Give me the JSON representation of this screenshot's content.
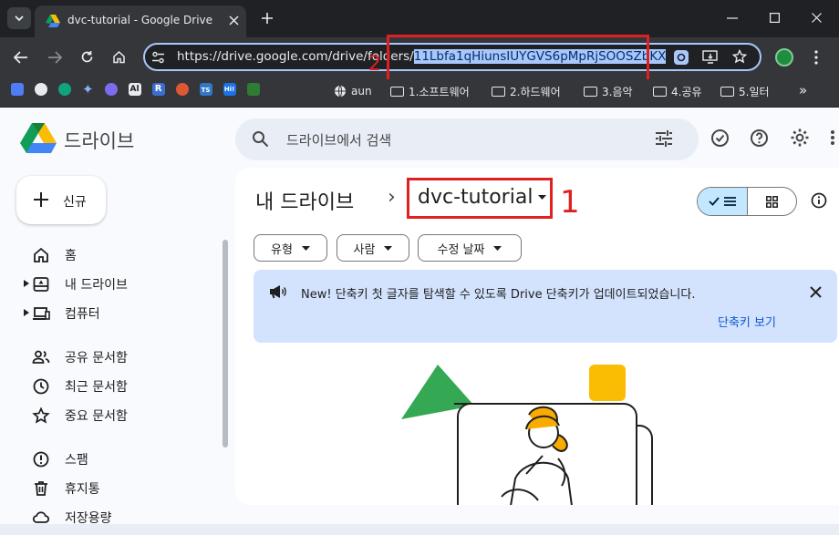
{
  "browser": {
    "tab_title": "dvc-tutorial - Google Drive",
    "url_prefix": "https://drive.google.com/drive/fold",
    "url_hidden": "ers/",
    "url_selected": "11Lbfa1qHiunsIUYGVS6pMpRjSOOSZbKX",
    "bookmarks": [
      "aun",
      "1.소프트웨어",
      "2.하드웨어",
      "3.음악",
      "4.공유",
      "5.일터"
    ],
    "bookmark_badges": [
      "Al",
      "R",
      "TS",
      "Hi!"
    ],
    "more": "»"
  },
  "drive": {
    "app_name": "드라이브",
    "search_placeholder": "드라이브에서 검색",
    "new_label": "신규",
    "nav": {
      "home": "홈",
      "my_drive": "내 드라이브",
      "computers": "컴퓨터",
      "shared": "공유 문서함",
      "recent": "최근 문서함",
      "starred": "중요 문서함",
      "spam": "스팸",
      "trash": "휴지통",
      "storage": "저장용량"
    },
    "breadcrumb_root": "내 드라이브",
    "breadcrumb_sep": "›",
    "current_folder": "dvc-tutorial",
    "filters": [
      "유형",
      "사람",
      "수정 날짜"
    ],
    "banner": {
      "text": "New! 단축키 첫 글자를 탐색할 수 있도록 Drive 단축키가 업데이트되었습니다.",
      "link": "단축키 보기"
    }
  },
  "annotations": {
    "marker_1": "1",
    "marker_2": "2"
  },
  "colors": {
    "annotation": "#e02020",
    "accent": "#0b57d0",
    "banner": "#d3e3fd",
    "selection": "#a8c7fa"
  }
}
